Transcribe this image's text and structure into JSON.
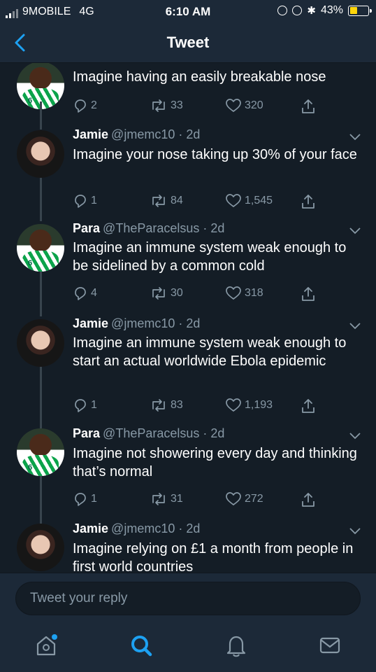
{
  "status_bar": {
    "carrier": "9MOBILE",
    "network": "4G",
    "time": "6:10 AM",
    "battery_percent": "43%",
    "battery_level": 0.43,
    "battery_color": "#ffd60a"
  },
  "nav": {
    "title": "Tweet",
    "back_icon": "chevron-left-icon"
  },
  "tweets": [
    {
      "name": "",
      "handle": "",
      "time": "",
      "text": "Imagine having an easily breakable nose",
      "replies": "2",
      "retweets": "33",
      "likes": "320"
    },
    {
      "name": "Jamie",
      "handle": "@jmemc10 · 2d",
      "text": "Imagine your nose taking up 30% of your face",
      "replies": "1",
      "retweets": "84",
      "likes": "1,545"
    },
    {
      "name": "Para",
      "handle": "@TheParacelsus · 2d",
      "text": "Imagine an immune system weak enough to be sidelined by a common cold",
      "replies": "4",
      "retweets": "30",
      "likes": "318"
    },
    {
      "name": "Jamie",
      "handle": "@jmemc10 · 2d",
      "text": "Imagine an immune system weak enough to start an actual worldwide Ebola epidemic",
      "replies": "1",
      "retweets": "83",
      "likes": "1,193"
    },
    {
      "name": "Para",
      "handle": "@TheParacelsus · 2d",
      "text": "Imagine not showering every day and thinking that’s normal",
      "replies": "1",
      "retweets": "31",
      "likes": "272"
    },
    {
      "name": "Jamie",
      "handle": "@jmemc10 · 2d",
      "text": "Imagine relying on £1 a month from people in first world countries",
      "replies": "",
      "retweets": "",
      "likes": ""
    }
  ],
  "reply_bar": {
    "placeholder": "Tweet your reply"
  },
  "tab_bar": {
    "tabs": [
      "home-icon",
      "search-icon",
      "notifications-icon",
      "messages-icon"
    ],
    "active": "search-icon",
    "accent": "#1da1f2"
  },
  "colors": {
    "background": "#141d26",
    "bar": "#1c2938",
    "secondary_text": "#8899a6",
    "accent": "#1da1f2"
  }
}
